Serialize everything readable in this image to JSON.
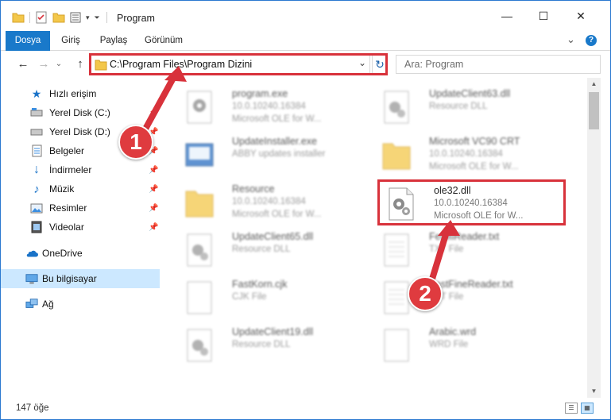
{
  "window": {
    "title": "Program",
    "minimize_glyph": "—",
    "maximize_glyph": "☐",
    "close_glyph": "✕"
  },
  "ribbon": {
    "tabs": [
      "Dosya",
      "Giriş",
      "Paylaş",
      "Görünüm"
    ],
    "active_tab": "Dosya",
    "expand_glyph": "⌄",
    "help_glyph": "?"
  },
  "nav": {
    "back_glyph": "←",
    "forward_glyph": "→",
    "recent_glyph": "⌄",
    "up_glyph": "↑",
    "address": "C:\\Program Files\\Program Dizini",
    "dropdown_glyph": "⌄",
    "refresh_glyph": "↻",
    "search_placeholder": "Ara: Program"
  },
  "sidebar": {
    "items": [
      {
        "label": "Hızlı erişim",
        "icon": "star-icon"
      },
      {
        "label": "Yerel Disk (C:)",
        "icon": "drive-icon",
        "pinned": true
      },
      {
        "label": "Yerel Disk (D:)",
        "icon": "drive-icon",
        "pinned": true
      },
      {
        "label": "Belgeler",
        "icon": "documents-icon",
        "pinned": true
      },
      {
        "label": "İndirmeler",
        "icon": "downloads-icon",
        "pinned": true
      },
      {
        "label": "Müzik",
        "icon": "music-icon",
        "pinned": true
      },
      {
        "label": "Resimler",
        "icon": "pictures-icon",
        "pinned": true
      },
      {
        "label": "Videolar",
        "icon": "videos-icon",
        "pinned": true
      },
      {
        "label": "OneDrive",
        "icon": "cloud-icon"
      },
      {
        "label": "Bu bilgisayar",
        "icon": "computer-icon",
        "selected": true
      },
      {
        "label": "Ağ",
        "icon": "network-icon"
      }
    ]
  },
  "files": [
    {
      "name": "program.exe",
      "line1": "10.0.10240.16384",
      "line2": "Microsoft OLE for W...",
      "icon": "exe-gear-icon"
    },
    {
      "name": "UpdateClient63.dll",
      "line1": "Resource DLL",
      "line2": "",
      "icon": "dll-gear-icon"
    },
    {
      "name": "UpdateInstaller.exe",
      "line1": "ABBY updates installer",
      "line2": "",
      "icon": "installer-icon"
    },
    {
      "name": "Microsoft VC90 CRT",
      "line1": "10.0.10240.16384",
      "line2": "Microsoft OLE for W...",
      "icon": "folder-icon"
    },
    {
      "name": "Resource",
      "line1": "10.0.10240.16384",
      "line2": "Microsoft OLE for W...",
      "icon": "folder-icon"
    },
    {
      "name": "ole32.dll",
      "line1": "10.0.10240.16384",
      "line2": "Microsoft OLE for W...",
      "icon": "dll-gear-icon",
      "highlighted": true
    },
    {
      "name": "UpdateClient65.dll",
      "line1": "Resource DLL",
      "line2": "",
      "icon": "dll-gear-icon"
    },
    {
      "name": "FetMiReader.txt",
      "line1": "TXT File",
      "line2": "",
      "icon": "text-file-icon"
    },
    {
      "name": "FastKorn.cjk",
      "line1": "CJK File",
      "line2": "",
      "icon": "blank-file-icon"
    },
    {
      "name": "FastFineReader.txt",
      "line1": "TXT File",
      "line2": "",
      "icon": "text-file-icon"
    },
    {
      "name": "UpdateClient19.dll",
      "line1": "Resource DLL",
      "line2": "",
      "icon": "dll-gear-icon"
    },
    {
      "name": "Arabic.wrd",
      "line1": "WRD File",
      "line2": "",
      "icon": "blank-file-icon"
    }
  ],
  "status": {
    "item_count": "147 öğe"
  },
  "annotations": {
    "step1": "1",
    "step2": "2",
    "color": "#d8323b"
  }
}
